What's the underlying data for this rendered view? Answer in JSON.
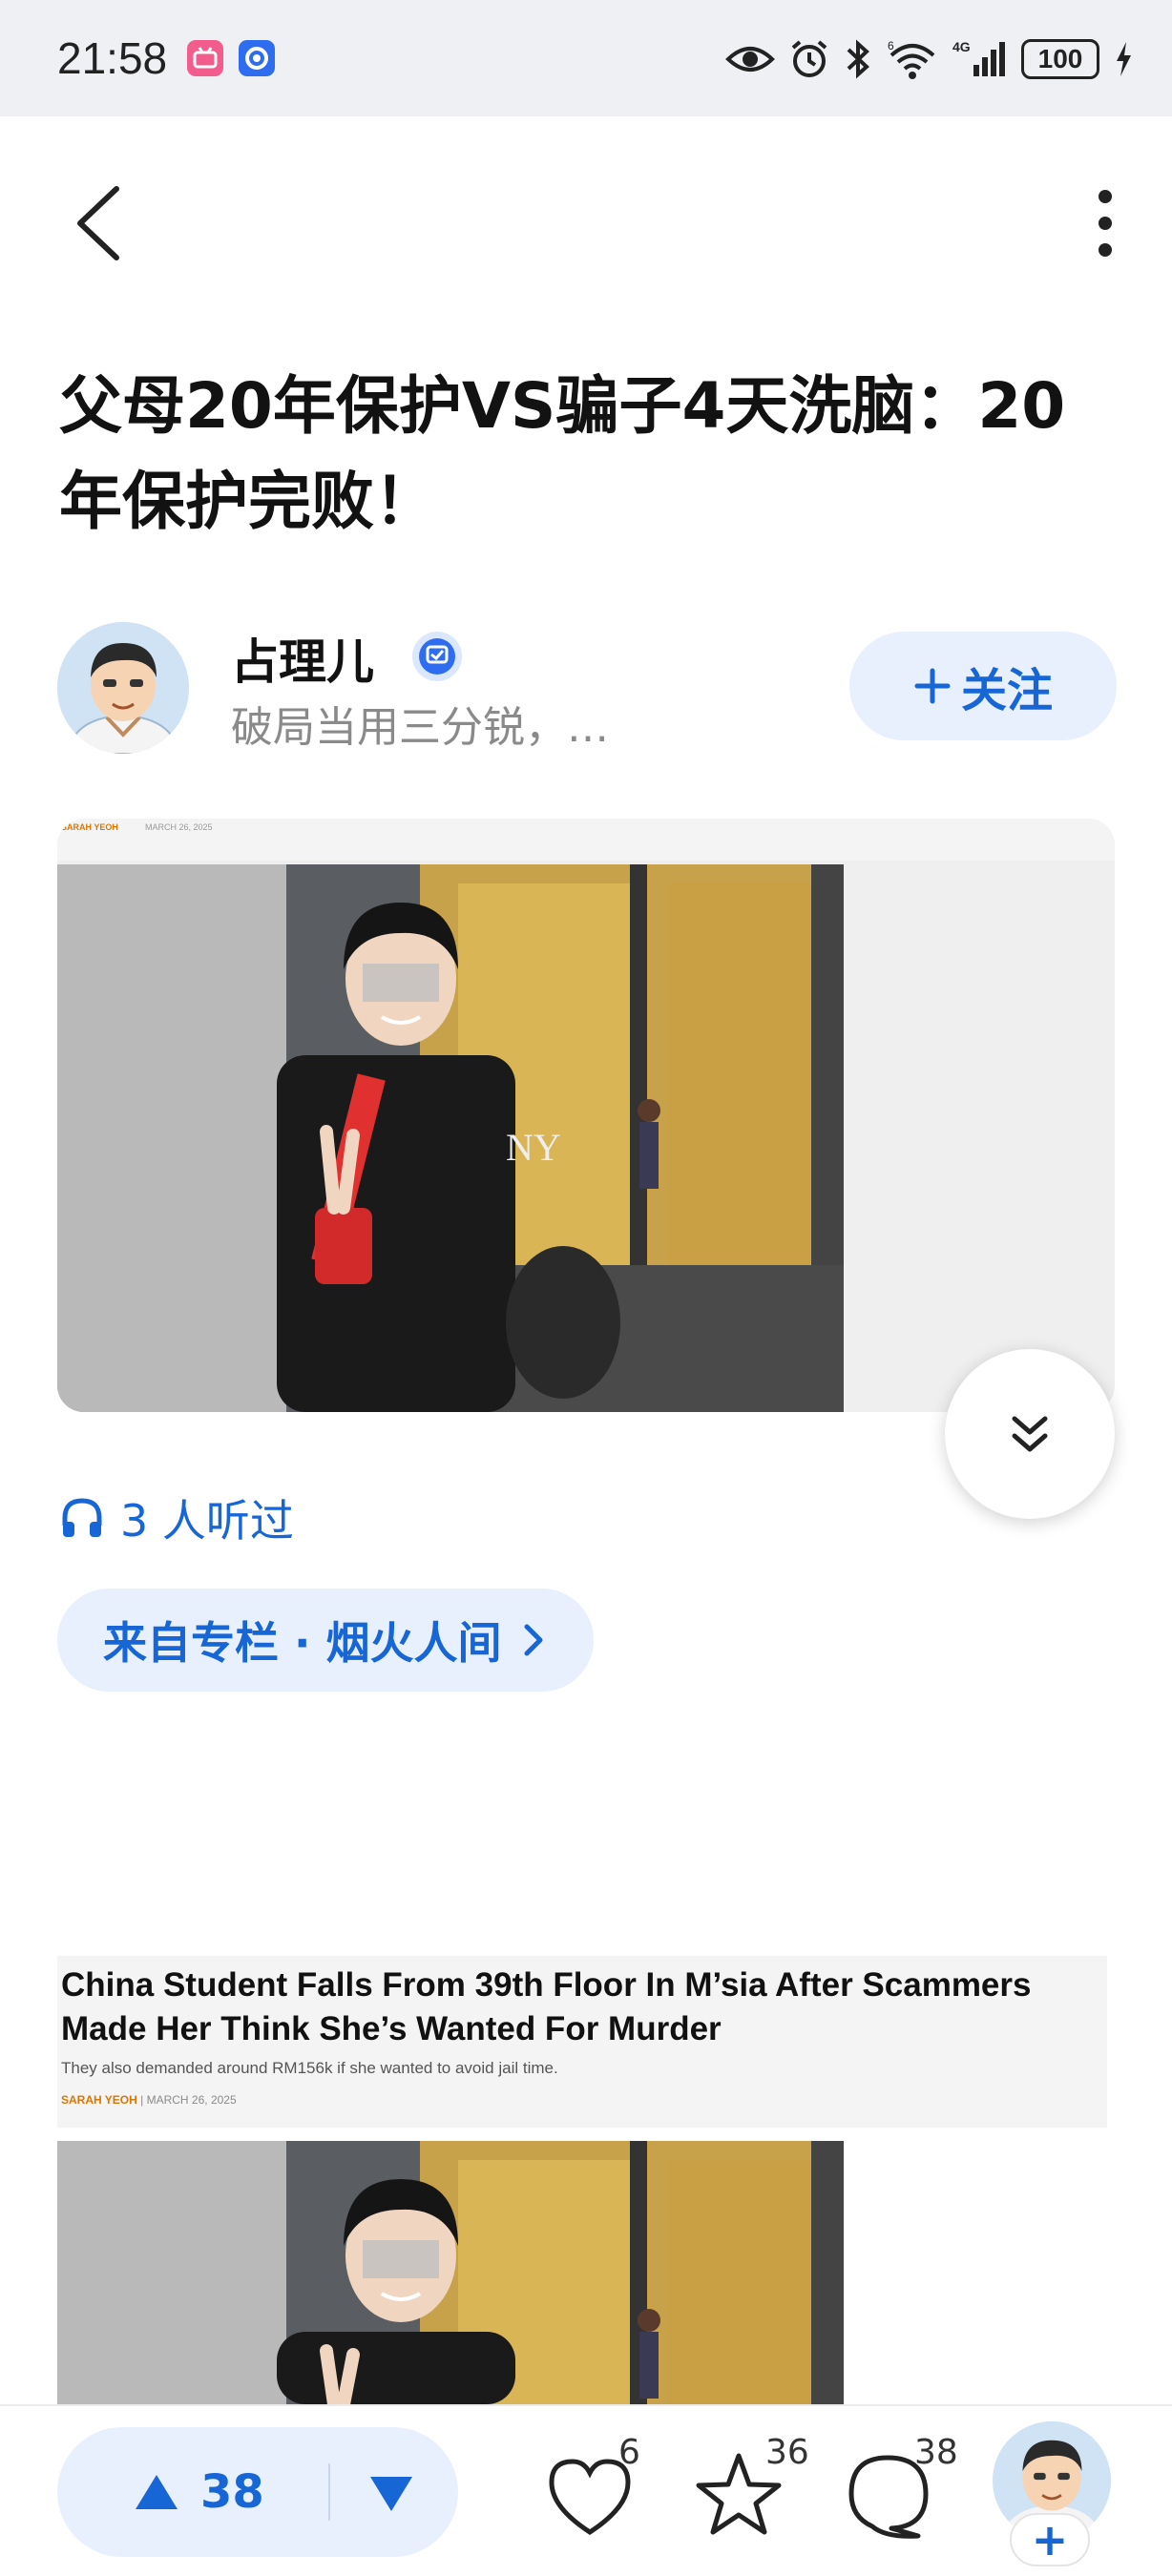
{
  "status_bar": {
    "time": "21:58",
    "battery": "100",
    "icons": [
      "bilibili-app-icon",
      "app-notification-icon",
      "eye-comfort-icon",
      "alarm-icon",
      "bluetooth-icon",
      "wifi-icon",
      "signal-4g-icon",
      "charging-icon"
    ],
    "network_label": "4G",
    "wifi_label": "6"
  },
  "nav": {
    "back_icon": "chevron-left-icon",
    "more_icon": "more-vertical-icon"
  },
  "article": {
    "title": "父母20年保护VS骗子4天洗脑：20年保护完败！",
    "author": {
      "name": "占理儿",
      "bio": "破局当用三分锐，…",
      "follow_label": "关注"
    },
    "listened_text": "3 人听过",
    "column_label": "来自专栏 · 烟火人间"
  },
  "image1_caption": {
    "byline_author": "SARAH YEOH",
    "byline_date": "MARCH 26, 2025"
  },
  "news_clip": {
    "headline": "China Student Falls From 39th Floor In M’sia After Scammers Made Her Think She’s Wanted For Murder",
    "subhead": "They also demanded around RM156k if she wanted to avoid jail time.",
    "byline_author": "SARAH YEOH",
    "byline_date": "MARCH 26, 2025"
  },
  "bottom_bar": {
    "upvotes": "38",
    "likes": "6",
    "favorites": "36",
    "comments": "38",
    "add_label": "+"
  },
  "colors": {
    "accent": "#1766d6",
    "accent_bg": "#e8f0fd",
    "status_bg": "#eef0f3"
  }
}
